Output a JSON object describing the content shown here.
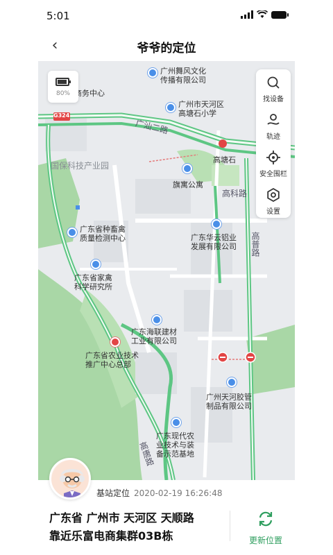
{
  "status_bar": {
    "time": "5:01"
  },
  "header": {
    "title": "爷爷的定位"
  },
  "map": {
    "battery": {
      "percent": "80%"
    },
    "tools": [
      {
        "label": "找设备",
        "icon": "search-icon"
      },
      {
        "label": "轨迹",
        "icon": "track-icon"
      },
      {
        "label": "安全围栏",
        "icon": "geofence-icon"
      },
      {
        "label": "设置",
        "icon": "settings-icon"
      }
    ],
    "pois": {
      "p1": "广州舞风文化",
      "p1b": "传播有限公司",
      "p2": "天保商务中心",
      "p3": "广州市天河区",
      "p3b": "高塘石小学",
      "p4": "高塘石",
      "p5": "国保科技产业园",
      "p6": "旗寓公寓",
      "p7": "广东省种畜禽",
      "p7b": "质量检测中心",
      "p8": "广东华云铝业",
      "p8b": "发展有限公司",
      "p9": "广东省家禽",
      "p9b": "科学研究所",
      "p10": "广东海联建材",
      "p10b": "工业有限公司",
      "p11": "广东省农业技术",
      "p11b": "推广中心总部",
      "p12": "广州天河胶管",
      "p12b": "制品有限公司",
      "p13": "广东现代农",
      "p13b": "业技术与装",
      "p13c": "备示范基地"
    },
    "roads": {
      "r1": "G324",
      "r2": "广汕二路",
      "r3": "高科路",
      "r4": "高普路",
      "r5": "高唐路"
    }
  },
  "location": {
    "source": "基站定位",
    "timestamp": "2020-02-19 16:26:48",
    "address_line1": "广东省 广州市 天河区 天顺路",
    "address_line2": "靠近乐富电商集群03B栋"
  },
  "refresh_label": "更新位置",
  "colors": {
    "accent": "#2e9e5e",
    "road_green": "#5dc683",
    "poi_blue": "#4a8fe8"
  }
}
